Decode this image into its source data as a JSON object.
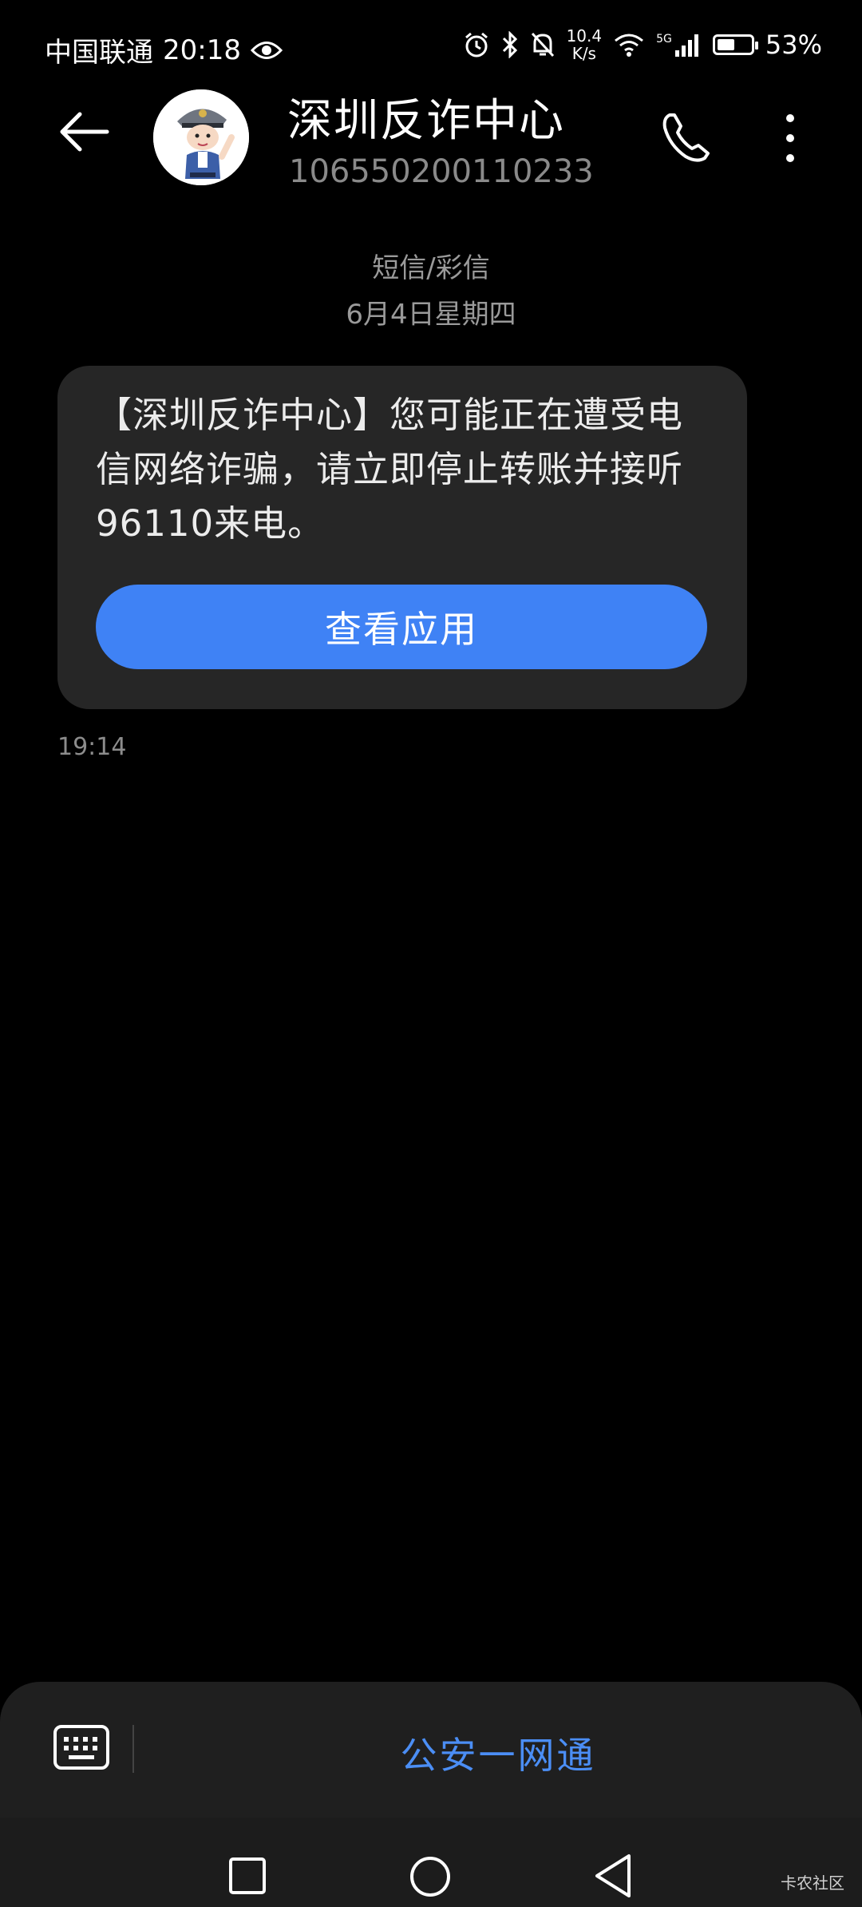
{
  "status_bar": {
    "carrier": "中国联通",
    "time": "20:18",
    "net_speed_value": "10.4",
    "net_speed_unit": "K/s",
    "network_type": "5G",
    "battery_percent": "53%",
    "battery_level": 0.53,
    "icons": [
      "eye-icon",
      "alarm-icon",
      "bluetooth-icon",
      "mute-bell-icon",
      "wifi-icon",
      "signal-icon",
      "battery-icon"
    ]
  },
  "header": {
    "contact_name": "深圳反诈中心",
    "contact_number": "106550200110233"
  },
  "conversation": {
    "message_type": "短信/彩信",
    "date": "6月4日星期四",
    "message": {
      "text": "【深圳反诈中心】您可能正在遭受电信网络诈骗，请立即停止转账并接听96110来电。",
      "button_label": "查看应用",
      "time": "19:14"
    }
  },
  "bottom": {
    "service_label": "公安一网通"
  },
  "watermark": "卡农社区",
  "colors": {
    "accent": "#3f82f5",
    "link": "#4b8ef5",
    "bubble": "#262626",
    "background": "#000000"
  }
}
